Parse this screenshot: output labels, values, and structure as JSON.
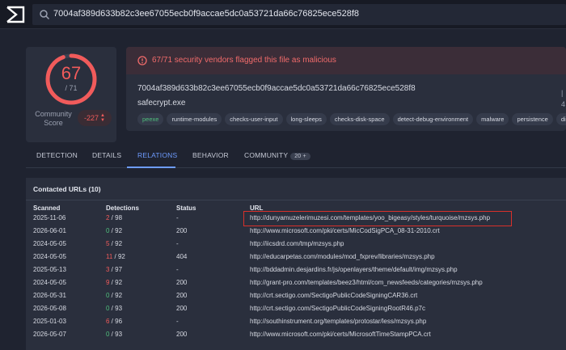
{
  "search": {
    "query": "7004af389d633b82c3ee67055ecb0f9accae5dc0a53721da66c76825ece528f8"
  },
  "score": {
    "positives": "67",
    "total": "/ 71",
    "community_label": "Community Score",
    "community_value": "-227"
  },
  "summary": {
    "alert": "67/71 security vendors flagged this file as malicious",
    "hash": "7004af389d633b82c3ee67055ecb0f9accae5dc0a53721da66c76825ece528f8",
    "filename": "safecrypt.exe",
    "tags": [
      "peexe",
      "runtime-modules",
      "checks-user-input",
      "long-sleeps",
      "checks-disk-space",
      "detect-debug-environment",
      "malware",
      "persistence",
      "direct-cpu-clock-a"
    ]
  },
  "tabs": [
    {
      "label": "DETECTION"
    },
    {
      "label": "DETAILS"
    },
    {
      "label": "RELATIONS"
    },
    {
      "label": "BEHAVIOR"
    },
    {
      "label": "COMMUNITY",
      "badge": "20 +"
    }
  ],
  "contacted": {
    "title": "Contacted URLs",
    "count": "(10)",
    "headers": {
      "scanned": "Scanned",
      "detections": "Detections",
      "status": "Status",
      "url": "URL"
    },
    "rows": [
      {
        "scanned": "2025-11-06",
        "pos": "2",
        "total": " / 98",
        "status": "-",
        "url": "http://dunyamuzelerimuzesi.com/templates/yoo_bigeasy/styles/turquoise/mzsys.php"
      },
      {
        "scanned": "2026-06-01",
        "pos": "0",
        "total": " / 92",
        "status": "200",
        "url": "http://www.microsoft.com/pki/certs/MicCodSigPCA_08-31-2010.crt"
      },
      {
        "scanned": "2024-05-05",
        "pos": "5",
        "total": " / 92",
        "status": "-",
        "url": "http://iicsdrd.com/tmp/mzsys.php"
      },
      {
        "scanned": "2024-05-05",
        "pos": "11",
        "total": " / 92",
        "status": "404",
        "url": "http://educarpetas.com/modules/mod_fxprev/libraries/mzsys.php"
      },
      {
        "scanned": "2025-05-13",
        "pos": "3",
        "total": " / 97",
        "status": "-",
        "url": "http://bddadmin.desjardins.fr/js/openlayers/theme/default/img/mzsys.php"
      },
      {
        "scanned": "2024-05-05",
        "pos": "9",
        "total": " / 92",
        "status": "200",
        "url": "http://grant-pro.com/templates/beez3/html/com_newsfeeds/categories/mzsys.php"
      },
      {
        "scanned": "2026-05-31",
        "pos": "0",
        "total": " / 92",
        "status": "200",
        "url": "http://crt.sectigo.com/SectigoPublicCodeSigningCAR36.crt"
      },
      {
        "scanned": "2026-05-08",
        "pos": "0",
        "total": " / 93",
        "status": "200",
        "url": "http://crt.sectigo.com/SectigoPublicCodeSigningRootR46.p7c"
      },
      {
        "scanned": "2025-01-03",
        "pos": "6",
        "total": " / 96",
        "status": "-",
        "url": "http://southinstrument.org/templates/protostar/less/mzsys.php"
      },
      {
        "scanned": "2026-05-07",
        "pos": "0",
        "total": " / 93",
        "status": "200",
        "url": "http://www.microsoft.com/pki/certs/MicrosoftTimeStampPCA.crt"
      }
    ]
  },
  "colors": {
    "malicious": "#f15b5b",
    "clean": "#4fbf7c",
    "accent": "#6e9cff",
    "highlight": "#d9302a"
  }
}
